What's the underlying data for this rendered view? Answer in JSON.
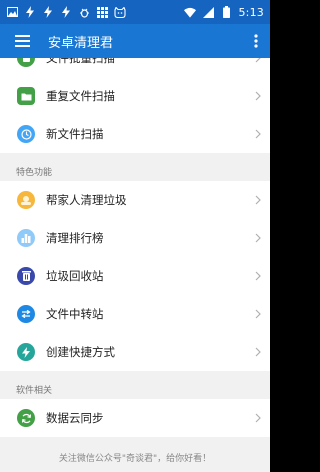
{
  "statusbar": {
    "time": "5:13"
  },
  "appbar": {
    "title": "安卓清理君"
  },
  "top_items": [
    {
      "label": "文件批量扫描",
      "icon": "file-scan-icon",
      "color": "#43a047"
    },
    {
      "label": "重复文件扫描",
      "icon": "folder-icon",
      "color": "#43a047"
    },
    {
      "label": "新文件扫描",
      "icon": "clock-icon",
      "color": "#42a5f5"
    }
  ],
  "sections": {
    "features": {
      "header": "特色功能",
      "items": [
        {
          "label": "帮家人清理垃圾",
          "icon": "family-icon",
          "color": "#f6b73c"
        },
        {
          "label": "清理排行榜",
          "icon": "ranking-icon",
          "color": "#90caf9"
        },
        {
          "label": "垃圾回收站",
          "icon": "recycle-bin-icon",
          "color": "#3949ab"
        },
        {
          "label": "文件中转站",
          "icon": "transfer-icon",
          "color": "#1e88e5"
        },
        {
          "label": "创建快捷方式",
          "icon": "lightning-icon",
          "color": "#26a69a"
        }
      ]
    },
    "software": {
      "header": "软件相关",
      "items": [
        {
          "label": "数据云同步",
          "icon": "sync-icon",
          "color": "#43a047"
        }
      ]
    }
  },
  "footer": {
    "text": "关注微信公众号\"奇谈君\"，给你好看！"
  },
  "colors": {
    "statusbar": "#1565c0",
    "appbar": "#1976d2"
  }
}
